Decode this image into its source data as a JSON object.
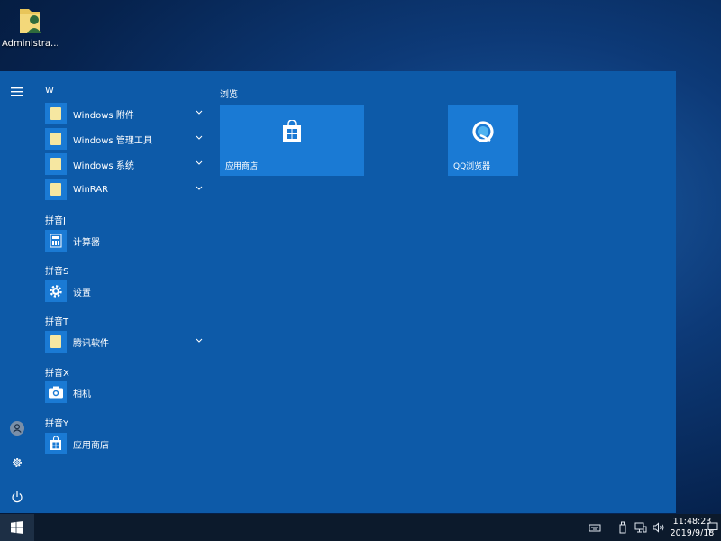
{
  "desktop": {
    "icons": [
      {
        "label": "Administra...",
        "icon": "user-folder-icon"
      }
    ]
  },
  "start_menu": {
    "rail": [
      {
        "name": "hamburger-menu-icon"
      },
      {
        "name": "user-account-icon"
      },
      {
        "name": "settings-gear-icon"
      },
      {
        "name": "power-icon"
      }
    ],
    "groups": [
      {
        "header": "W",
        "items": [
          {
            "label": "Windows 附件",
            "icon": "folder-icon",
            "expandable": true
          },
          {
            "label": "Windows 管理工具",
            "icon": "folder-icon",
            "expandable": true
          },
          {
            "label": "Windows 系统",
            "icon": "folder-icon",
            "expandable": true
          },
          {
            "label": "WinRAR",
            "icon": "folder-icon",
            "expandable": true
          }
        ]
      },
      {
        "header": "拼音J",
        "items": [
          {
            "label": "计算器",
            "icon": "calculator-icon",
            "expandable": false
          }
        ]
      },
      {
        "header": "拼音S",
        "items": [
          {
            "label": "设置",
            "icon": "gear-icon",
            "expandable": false
          }
        ]
      },
      {
        "header": "拼音T",
        "items": [
          {
            "label": "腾讯软件",
            "icon": "folder-icon",
            "expandable": true
          }
        ]
      },
      {
        "header": "拼音X",
        "items": [
          {
            "label": "相机",
            "icon": "camera-icon",
            "expandable": false
          }
        ]
      },
      {
        "header": "拼音Y",
        "items": [
          {
            "label": "应用商店",
            "icon": "store-icon",
            "expandable": false
          }
        ]
      }
    ],
    "tiles_header": "浏览",
    "tiles": [
      {
        "label": "应用商店",
        "icon": "store-icon"
      },
      {
        "label": "QQ浏览器",
        "icon": "qq-browser-icon"
      }
    ]
  },
  "taskbar": {
    "start_icon": "windows-logo-icon",
    "tray_icons": [
      "keyboard-icon",
      "usb-icon",
      "network-icon",
      "volume-icon"
    ],
    "time": "11:48:23",
    "date": "2019/9/18",
    "notification_icon": "notification-icon"
  },
  "colors": {
    "menu_bg": "#0d5aa8",
    "tile_bg": "#1a7ad4",
    "taskbar_bg": "#0c1a2c",
    "folder": "#f6e7a1"
  }
}
